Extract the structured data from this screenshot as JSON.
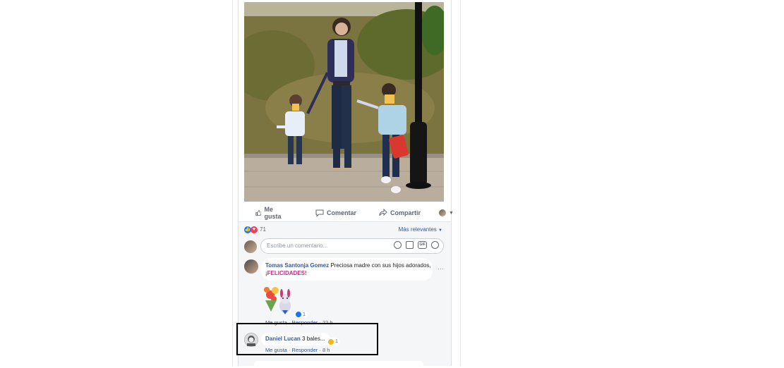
{
  "actions": {
    "like": "Me gusta",
    "comment": "Comentar",
    "share": "Compartir"
  },
  "reactions": {
    "count": "71",
    "sort": "Más relevantes"
  },
  "composer": {
    "placeholder": "Escribe un comentario..."
  },
  "comments": [
    {
      "author": "Tomas Santonja Gomez",
      "text": "Preciosa madre con sus hijos adorados,",
      "highlight": "¡FELICIDADES!",
      "sticker_reaction_count": "1",
      "like_label": "Me gusta",
      "reply_label": "Responder",
      "time": "22 h"
    },
    {
      "author": "Daniel Lucan",
      "text": "3 bales...",
      "reaction_count": "1",
      "like_label": "Me gusta",
      "reply_label": "Responder",
      "time": "8 h"
    }
  ],
  "colors": {
    "link": "#385898",
    "like_blue": "#1877f2",
    "love_red": "#f33e58",
    "highlight_pink": "#c42a8c"
  }
}
